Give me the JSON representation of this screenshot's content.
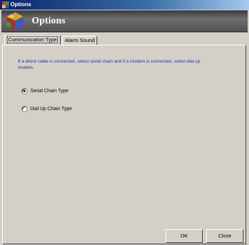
{
  "window": {
    "title": "Options"
  },
  "header": {
    "title": "Options"
  },
  "tabs": [
    {
      "label": "Communication Type",
      "active": true
    },
    {
      "label": "Alarm Sound",
      "active": false
    }
  ],
  "description": "If a direct cable is connected, select serial chain and if a modem is connected, select dial up modem.",
  "options": [
    {
      "label": "Serial Chain Type",
      "selected": true
    },
    {
      "label": "Dial Up Chain Type",
      "selected": false
    }
  ],
  "buttons": {
    "ok": "OK",
    "close": "Close"
  },
  "colors": {
    "title_bar": "#0a246a",
    "description_text": "#2233aa",
    "face": "#d4d0c8"
  },
  "icons": {
    "title": "options-app-icon",
    "header": "multicolor-cube-logo"
  }
}
